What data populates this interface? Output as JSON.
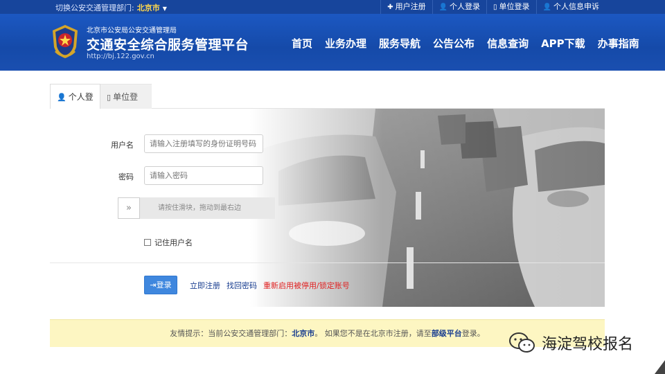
{
  "topbar": {
    "switch_label": "切换公安交通管理部门:",
    "city": "北京市",
    "links": [
      {
        "icon": "plus-icon",
        "label": "用户注册"
      },
      {
        "icon": "user-icon",
        "label": "个人登录"
      },
      {
        "icon": "building-icon",
        "label": "单位登录"
      },
      {
        "icon": "user-icon",
        "label": "个人信息申诉"
      }
    ]
  },
  "header": {
    "org": "北京市公安局公安交通管理局",
    "title": "交通安全综合服务管理平台",
    "url": "http://bj.122.gov.cn",
    "nav": [
      "首页",
      "业务办理",
      "服务导航",
      "公告公布",
      "信息查询",
      "APP下载",
      "办事指南"
    ]
  },
  "tabs": {
    "personal": "个人登录",
    "unit": "单位登录"
  },
  "form": {
    "username_label": "用户名",
    "username_placeholder": "请输入注册填写的身份证明号码",
    "password_label": "密码",
    "password_placeholder": "请输入密码",
    "slider_handle": "»",
    "slider_text": "请按住滑块，拖动到最右边",
    "remember_label": "记住用户名"
  },
  "actions": {
    "login": "登录",
    "register": "立即注册",
    "recover": "找回密码",
    "reactivate": "重新启用被停用/锁定账号"
  },
  "tip": {
    "prefix": "友情提示：当前公安交通管理部门：",
    "city": "北京市",
    "middle": "。 如果您不是在北京市注册，请至",
    "platform": "部级平台",
    "suffix": "登录。"
  },
  "watermark": {
    "text": "海淀驾校报名"
  },
  "colors": {
    "header_blue": "#1a4fb0",
    "accent_yellow": "#ffd84d",
    "login_button": "#3f87de",
    "link_blue": "#173c8f",
    "link_red": "#e02020",
    "tip_bg": "#fdf6c2"
  }
}
